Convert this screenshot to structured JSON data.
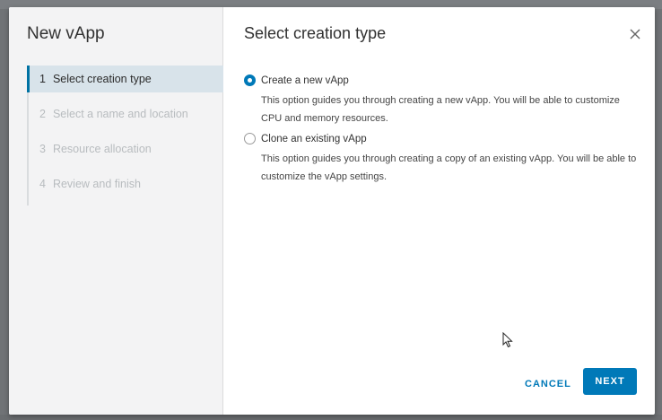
{
  "wizard": {
    "title": "New vApp",
    "steps": [
      {
        "num": "1",
        "label": "Select creation type",
        "state": "active"
      },
      {
        "num": "2",
        "label": "Select a name and location",
        "state": "disabled"
      },
      {
        "num": "3",
        "label": "Resource allocation",
        "state": "disabled"
      },
      {
        "num": "4",
        "label": "Review and finish",
        "state": "disabled"
      }
    ]
  },
  "content": {
    "title": "Select creation type",
    "options": [
      {
        "label": "Create a new vApp",
        "description": "This option guides you through creating a new vApp. You will be able to customize CPU and memory resources.",
        "selected": true
      },
      {
        "label": "Clone an existing vApp",
        "description": "This option guides you through creating a copy of an existing vApp. You will be able to customize the vApp settings.",
        "selected": false
      }
    ]
  },
  "footer": {
    "cancel_label": "CANCEL",
    "next_label": "NEXT"
  },
  "icons": {
    "close": "close-icon",
    "cursor": "mouse-pointer-icon"
  },
  "colors": {
    "accent": "#0079b8",
    "active_step_bg": "#d8e3ea",
    "nav_bg": "#f3f3f4"
  }
}
